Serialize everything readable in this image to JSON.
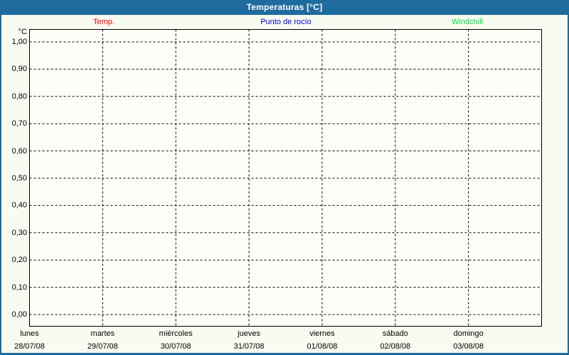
{
  "window": {
    "title": "Temperaturas [°C]"
  },
  "legend": {
    "items": [
      {
        "id": "temp",
        "label": "Temp.",
        "color": "#ff0000"
      },
      {
        "id": "punto-de-rocio",
        "label": "Punto de rocío",
        "color": "#0000dd"
      },
      {
        "id": "windchill",
        "label": "Windchill",
        "color": "#00dd44"
      }
    ]
  },
  "chart_data": {
    "type": "line",
    "title": "Temperaturas [°C]",
    "xlabel": "",
    "ylabel": "°C",
    "ylim": [
      0.0,
      1.0
    ],
    "ytick_interval": 0.1,
    "ytick_labels": [
      "0,00",
      "0,10",
      "0,20",
      "0,30",
      "0,40",
      "0,50",
      "0,60",
      "0,70",
      "0,80",
      "0,90",
      "1,00"
    ],
    "grid": "dashed",
    "legend_position": "top",
    "categories": [
      {
        "day": "lunes",
        "date": "28/07/08"
      },
      {
        "day": "martes",
        "date": "29/07/08"
      },
      {
        "day": "miércoles",
        "date": "30/07/08"
      },
      {
        "day": "jueves",
        "date": "31/07/08"
      },
      {
        "day": "viernes",
        "date": "01/08/08"
      },
      {
        "day": "sábado",
        "date": "02/08/08"
      },
      {
        "day": "domingo",
        "date": "03/08/08"
      }
    ],
    "series": [
      {
        "name": "Temp.",
        "color": "#ff0000",
        "values": []
      },
      {
        "name": "Punto de rocío",
        "color": "#0000dd",
        "values": []
      },
      {
        "name": "Windchill",
        "color": "#00dd44",
        "values": []
      }
    ]
  },
  "colors": {
    "titlebar": "#1e6b9e",
    "frame": "#1e6b9e",
    "background": "#f8fbf0",
    "plot_background": "#fdfef9",
    "grid": "#000000",
    "text": "#000000",
    "title_text": "#ffffff"
  }
}
